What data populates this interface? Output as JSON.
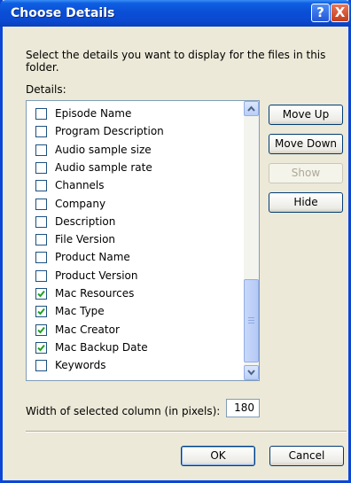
{
  "window": {
    "title": "Choose Details"
  },
  "titlebar": {
    "help_glyph": "?",
    "close_glyph": "X"
  },
  "prompt": "Select the details you want to display for the files in this folder.",
  "details_label": "Details:",
  "items": [
    {
      "label": "Episode Name",
      "checked": false
    },
    {
      "label": "Program Description",
      "checked": false
    },
    {
      "label": "Audio sample size",
      "checked": false
    },
    {
      "label": "Audio sample rate",
      "checked": false
    },
    {
      "label": "Channels",
      "checked": false
    },
    {
      "label": "Company",
      "checked": false
    },
    {
      "label": "Description",
      "checked": false
    },
    {
      "label": "File Version",
      "checked": false
    },
    {
      "label": "Product Name",
      "checked": false
    },
    {
      "label": "Product Version",
      "checked": false
    },
    {
      "label": "Mac Resources",
      "checked": true
    },
    {
      "label": "Mac Type",
      "checked": true
    },
    {
      "label": "Mac Creator",
      "checked": true
    },
    {
      "label": "Mac Backup Date",
      "checked": true
    },
    {
      "label": "Keywords",
      "checked": false
    }
  ],
  "buttons": {
    "move_up": "Move Up",
    "move_down": "Move Down",
    "show": "Show",
    "hide": "Hide",
    "ok": "OK",
    "cancel": "Cancel"
  },
  "width_label": "Width of selected column (in pixels):",
  "width_value": "180",
  "colors": {
    "title_bar": "#0a49d0",
    "check": "#21a121",
    "face": "#ece9d8"
  }
}
